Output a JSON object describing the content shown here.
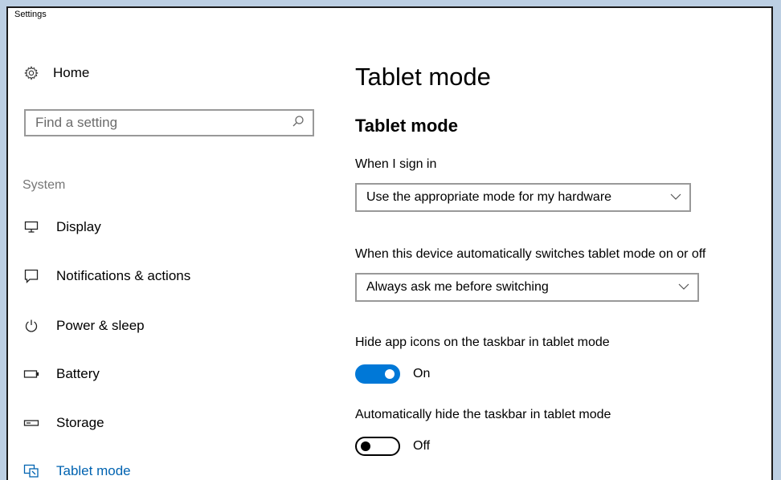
{
  "window": {
    "title": "Settings"
  },
  "sidebar": {
    "home_label": "Home",
    "search_placeholder": "Find a setting",
    "section_label": "System",
    "items": [
      {
        "label": "Display",
        "icon": "monitor-icon"
      },
      {
        "label": "Notifications & actions",
        "icon": "notification-icon"
      },
      {
        "label": "Power & sleep",
        "icon": "power-icon"
      },
      {
        "label": "Battery",
        "icon": "battery-icon"
      },
      {
        "label": "Storage",
        "icon": "storage-icon"
      },
      {
        "label": "Tablet mode",
        "icon": "tablet-mode-icon",
        "active": true
      }
    ]
  },
  "main": {
    "page_title": "Tablet mode",
    "section_title": "Tablet mode",
    "signin_label": "When I sign in",
    "signin_value": "Use the appropriate mode for my hardware",
    "switch_label": "When this device automatically switches tablet mode on or off",
    "switch_value": "Always ask me before switching",
    "hide_icons_label": "Hide app icons on the taskbar in tablet mode",
    "hide_icons_state": "On",
    "hide_taskbar_label": "Automatically hide the taskbar in tablet mode",
    "hide_taskbar_state": "Off"
  },
  "colors": {
    "accent": "#0078d7",
    "active_nav": "#0063b1",
    "background_frame": "#bccfe3"
  }
}
